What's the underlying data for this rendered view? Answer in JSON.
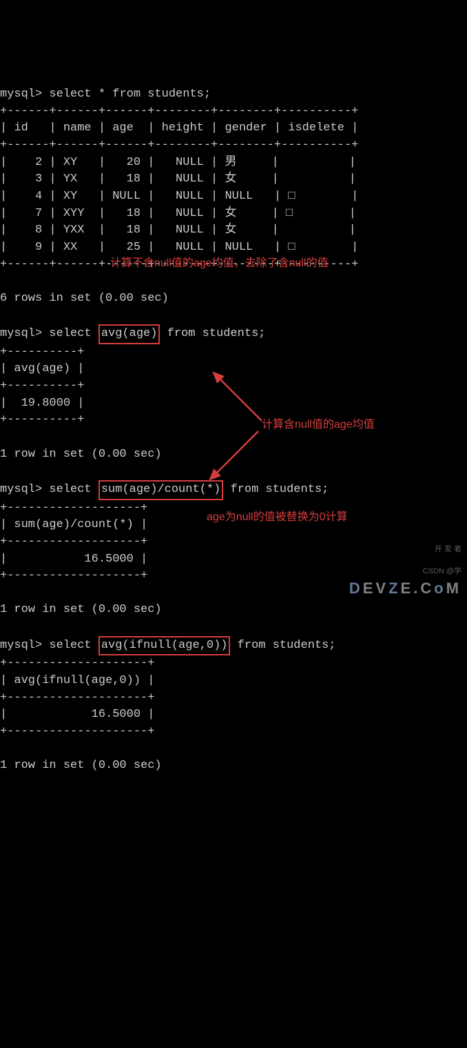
{
  "queries": {
    "q1": {
      "prompt": "mysql> ",
      "sql": "select * from students;",
      "headers": [
        "id",
        "name",
        "age",
        "height",
        "gender",
        "isdelete"
      ],
      "sep_top": "+------+------+------+--------+--------+----------+",
      "header_row": "| id   | name | age  | height | gender | isdelete |",
      "sep_mid": "+------+------+------+--------+--------+----------+",
      "rows_text": [
        "|    2 | XY   |   20 |   NULL | 男     |          |",
        "|    3 | YX   |   18 |   NULL | 女     |          |",
        "|    4 | XY   | NULL |   NULL | NULL   | □        |",
        "|    7 | XYY  |   18 |   NULL | 女     | □        |",
        "|    8 | YXX  |   18 |   NULL | 女     |          |",
        "|    9 | XX   |   25 |   NULL | NULL   | □        |"
      ],
      "sep_bot": "+------+------+------+--------+--------+----------+",
      "footer": "6 rows in set (0.00 sec)"
    },
    "q2": {
      "prompt": "mysql> ",
      "sql_before": "select ",
      "sql_box": "avg(age)",
      "sql_after": " from students;",
      "sep": "+----------+",
      "header": "| avg(age) |",
      "value": "|  19.8000 |",
      "footer": "1 row in set (0.00 sec)"
    },
    "q3": {
      "prompt": "mysql> ",
      "sql_before": "select ",
      "sql_box": "sum(age)/count(*)",
      "sql_after": " from students;",
      "sep": "+-------------------+",
      "header": "| sum(age)/count(*) |",
      "value": "|           16.5000 |",
      "footer": "1 row in set (0.00 sec)"
    },
    "q4": {
      "prompt": "mysql> ",
      "sql_before": "select ",
      "sql_box": "avg(ifnull(age,0))",
      "sql_after": " from students;",
      "sep": "+--------------------+",
      "header": "| avg(ifnull(age,0)) |",
      "value": "|            16.5000 |",
      "footer": "1 row in set (0.00 sec)"
    }
  },
  "annotations": {
    "a1": "计算不含null值的age均值，去除了含null的值",
    "a2": "计算含null值的age均值",
    "a3": "age为null的值被替换为0计算"
  },
  "watermark": {
    "line1": "开 发 者",
    "line2_a": "D",
    "line2_b": "EV",
    "line2_c": "Z",
    "line2_d": "E.C",
    "line2_e": "o",
    "line2_f": "M",
    "csdn": "CSDN @学"
  }
}
